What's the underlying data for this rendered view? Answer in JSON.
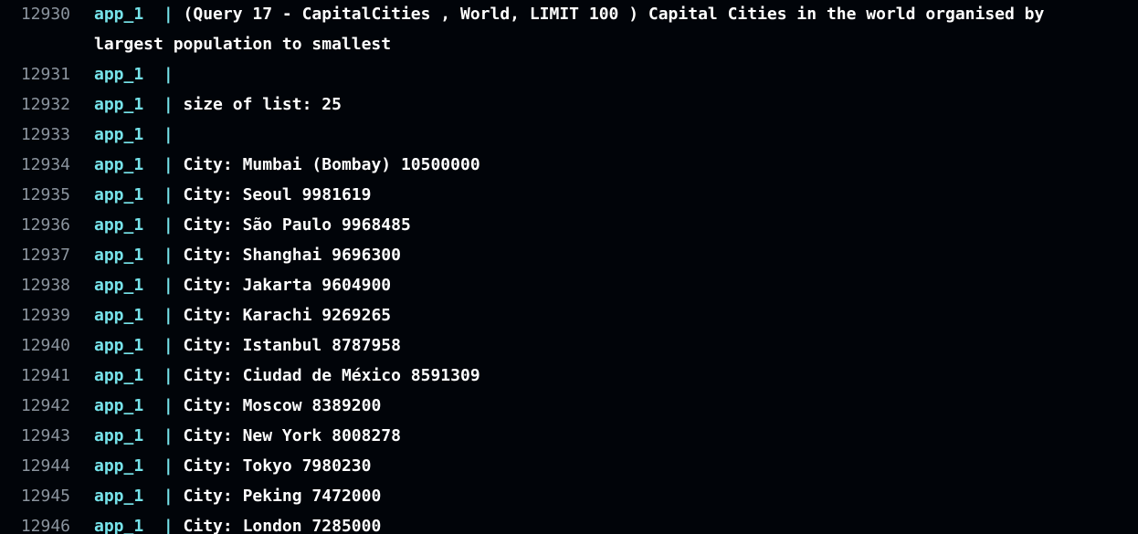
{
  "log": {
    "lines": [
      {
        "num": "12930",
        "service": "app_1",
        "separator": "  | ",
        "message": "(Query 17 - CapitalCities , World, LIMIT 100 ) Capital Cities in the world organised by largest population to smallest"
      },
      {
        "num": "12931",
        "service": "app_1",
        "separator": "  |",
        "message": ""
      },
      {
        "num": "12932",
        "service": "app_1",
        "separator": "  | ",
        "message": "size of list: 25"
      },
      {
        "num": "12933",
        "service": "app_1",
        "separator": "  |",
        "message": ""
      },
      {
        "num": "12934",
        "service": "app_1",
        "separator": "  | ",
        "message": "City: Mumbai (Bombay) 10500000"
      },
      {
        "num": "12935",
        "service": "app_1",
        "separator": "  | ",
        "message": "City: Seoul 9981619"
      },
      {
        "num": "12936",
        "service": "app_1",
        "separator": "  | ",
        "message": "City: São Paulo 9968485"
      },
      {
        "num": "12937",
        "service": "app_1",
        "separator": "  | ",
        "message": "City: Shanghai 9696300"
      },
      {
        "num": "12938",
        "service": "app_1",
        "separator": "  | ",
        "message": "City: Jakarta 9604900"
      },
      {
        "num": "12939",
        "service": "app_1",
        "separator": "  | ",
        "message": "City: Karachi 9269265"
      },
      {
        "num": "12940",
        "service": "app_1",
        "separator": "  | ",
        "message": "City: Istanbul 8787958"
      },
      {
        "num": "12941",
        "service": "app_1",
        "separator": "  | ",
        "message": "City: Ciudad de México 8591309"
      },
      {
        "num": "12942",
        "service": "app_1",
        "separator": "  | ",
        "message": "City: Moscow 8389200"
      },
      {
        "num": "12943",
        "service": "app_1",
        "separator": "  | ",
        "message": "City: New York 8008278"
      },
      {
        "num": "12944",
        "service": "app_1",
        "separator": "  | ",
        "message": "City: Tokyo 7980230"
      },
      {
        "num": "12945",
        "service": "app_1",
        "separator": "  | ",
        "message": "City: Peking 7472000"
      },
      {
        "num": "12946",
        "service": "app_1",
        "separator": "  | ",
        "message": "City: London 7285000"
      }
    ]
  }
}
